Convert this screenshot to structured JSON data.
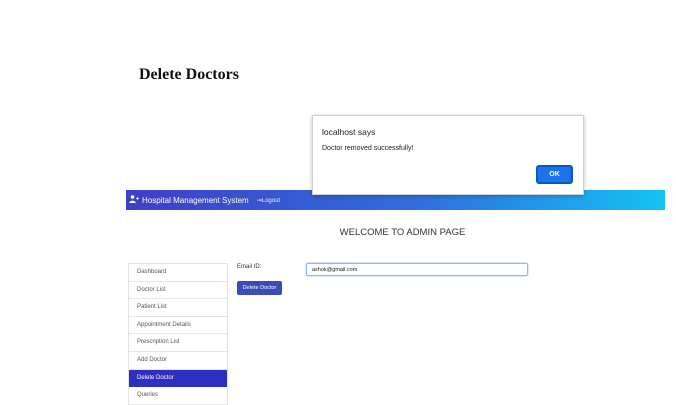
{
  "page": {
    "heading": "Delete Doctors"
  },
  "navbar": {
    "brand": "Hospital Management System",
    "logout": "Logout",
    "brand_icon": "user-plus-icon",
    "logout_icon": "sign-out-icon",
    "gradient_colors": [
      "#3f3fc4",
      "#2f6fdc",
      "#14c2f4"
    ]
  },
  "main": {
    "welcome": "WELCOME TO ADMIN PAGE"
  },
  "sidebar": {
    "items": [
      {
        "label": "Dashboard"
      },
      {
        "label": "Doctor List"
      },
      {
        "label": "Patient List"
      },
      {
        "label": "Appointment Details"
      },
      {
        "label": "Prescription List"
      },
      {
        "label": "Add Doctor"
      },
      {
        "label": "Delete Doctor",
        "active": true
      },
      {
        "label": "Queries"
      }
    ],
    "active_color": "#2d2fbf"
  },
  "form": {
    "email_label": "Email ID:",
    "email_value": "ashok@gmail.com",
    "submit_label": "Delete Doctor"
  },
  "alert": {
    "title": "localhost says",
    "message": "Doctor removed successfully!",
    "ok_label": "OK"
  }
}
